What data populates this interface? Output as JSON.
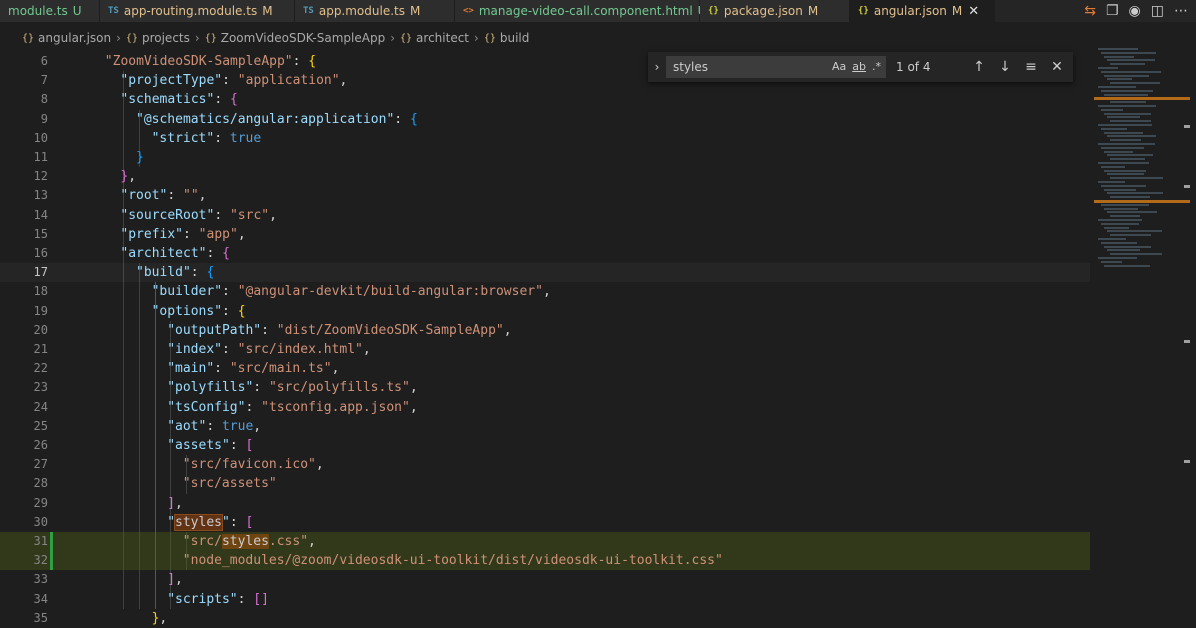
{
  "tabs": [
    {
      "icon": "",
      "label": "module.ts",
      "mark": "U",
      "icon_color": "",
      "label_color": "#73c991",
      "active": false
    },
    {
      "icon": "TS",
      "label": "app-routing.module.ts",
      "mark": "M",
      "icon_color": "#519aba",
      "label_color": "#e2c08d",
      "active": false
    },
    {
      "icon": "TS",
      "label": "app.module.ts",
      "mark": "M",
      "icon_color": "#519aba",
      "label_color": "#e2c08d",
      "active": false
    },
    {
      "icon": "<>",
      "label": "manage-video-call.component.html",
      "mark": "U",
      "icon_color": "#e37933",
      "label_color": "#73c991",
      "active": false
    },
    {
      "icon": "{}",
      "label": "package.json",
      "mark": "M",
      "icon_color": "#cbcb41",
      "label_color": "#e2c08d",
      "active": false
    },
    {
      "icon": "{}",
      "label": "angular.json",
      "mark": "M",
      "icon_color": "#cbcb41",
      "label_color": "#e2c08d",
      "active": true
    }
  ],
  "breadcrumb": [
    {
      "icon": "{}",
      "label": "angular.json"
    },
    {
      "icon": "{}",
      "label": "projects"
    },
    {
      "icon": "{}",
      "label": "ZoomVideoSDK-SampleApp"
    },
    {
      "icon": "{}",
      "label": "architect"
    },
    {
      "icon": "{}",
      "label": "build"
    }
  ],
  "find": {
    "query": "styles",
    "match_case": "Aa",
    "whole_word": "ab",
    "regex": ".*",
    "count": "1 of 4"
  },
  "editor": {
    "lines": [
      {
        "n": "6",
        "indent": 6,
        "tokens": [
          [
            "s",
            "\"ZoomVideoSDK-SampleApp\""
          ],
          [
            "p",
            ": "
          ],
          [
            "br1",
            "{"
          ]
        ]
      },
      {
        "n": "7",
        "indent": 8,
        "tokens": [
          [
            "k",
            "\"projectType\""
          ],
          [
            "p",
            ": "
          ],
          [
            "s",
            "\"application\""
          ],
          [
            "p",
            ","
          ]
        ]
      },
      {
        "n": "8",
        "indent": 8,
        "tokens": [
          [
            "k",
            "\"schematics\""
          ],
          [
            "p",
            ": "
          ],
          [
            "br2",
            "{"
          ]
        ]
      },
      {
        "n": "9",
        "indent": 10,
        "tokens": [
          [
            "k",
            "\"@schematics/angular:application\""
          ],
          [
            "p",
            ": "
          ],
          [
            "br3",
            "{"
          ]
        ]
      },
      {
        "n": "10",
        "indent": 12,
        "tokens": [
          [
            "k",
            "\"strict\""
          ],
          [
            "p",
            ": "
          ],
          [
            "b",
            "true"
          ]
        ]
      },
      {
        "n": "11",
        "indent": 10,
        "tokens": [
          [
            "br3",
            "}"
          ]
        ]
      },
      {
        "n": "12",
        "indent": 8,
        "tokens": [
          [
            "br2",
            "}"
          ],
          [
            "p",
            ","
          ]
        ]
      },
      {
        "n": "13",
        "indent": 8,
        "tokens": [
          [
            "k",
            "\"root\""
          ],
          [
            "p",
            ": "
          ],
          [
            "s",
            "\"\""
          ],
          [
            "p",
            ","
          ]
        ]
      },
      {
        "n": "14",
        "indent": 8,
        "tokens": [
          [
            "k",
            "\"sourceRoot\""
          ],
          [
            "p",
            ": "
          ],
          [
            "s",
            "\"src\""
          ],
          [
            "p",
            ","
          ]
        ]
      },
      {
        "n": "15",
        "indent": 8,
        "tokens": [
          [
            "k",
            "\"prefix\""
          ],
          [
            "p",
            ": "
          ],
          [
            "s",
            "\"app\""
          ],
          [
            "p",
            ","
          ]
        ]
      },
      {
        "n": "16",
        "indent": 8,
        "tokens": [
          [
            "k",
            "\"architect\""
          ],
          [
            "p",
            ": "
          ],
          [
            "br2",
            "{"
          ]
        ]
      },
      {
        "n": "17",
        "indent": 10,
        "tokens": [
          [
            "k",
            "\"build\""
          ],
          [
            "p",
            ": "
          ],
          [
            "br3",
            "{"
          ]
        ]
      },
      {
        "n": "18",
        "indent": 12,
        "tokens": [
          [
            "k",
            "\"builder\""
          ],
          [
            "p",
            ": "
          ],
          [
            "s",
            "\"@angular-devkit/build-angular:browser\""
          ],
          [
            "p",
            ","
          ]
        ]
      },
      {
        "n": "19",
        "indent": 12,
        "tokens": [
          [
            "k",
            "\"options\""
          ],
          [
            "p",
            ": "
          ],
          [
            "br1",
            "{"
          ]
        ]
      },
      {
        "n": "20",
        "indent": 14,
        "tokens": [
          [
            "k",
            "\"outputPath\""
          ],
          [
            "p",
            ": "
          ],
          [
            "s",
            "\"dist/ZoomVideoSDK-SampleApp\""
          ],
          [
            "p",
            ","
          ]
        ]
      },
      {
        "n": "21",
        "indent": 14,
        "tokens": [
          [
            "k",
            "\"index\""
          ],
          [
            "p",
            ": "
          ],
          [
            "s",
            "\"src/index.html\""
          ],
          [
            "p",
            ","
          ]
        ]
      },
      {
        "n": "22",
        "indent": 14,
        "tokens": [
          [
            "k",
            "\"main\""
          ],
          [
            "p",
            ": "
          ],
          [
            "s",
            "\"src/main.ts\""
          ],
          [
            "p",
            ","
          ]
        ]
      },
      {
        "n": "23",
        "indent": 14,
        "tokens": [
          [
            "k",
            "\"polyfills\""
          ],
          [
            "p",
            ": "
          ],
          [
            "s",
            "\"src/polyfills.ts\""
          ],
          [
            "p",
            ","
          ]
        ]
      },
      {
        "n": "24",
        "indent": 14,
        "tokens": [
          [
            "k",
            "\"tsConfig\""
          ],
          [
            "p",
            ": "
          ],
          [
            "s",
            "\"tsconfig.app.json\""
          ],
          [
            "p",
            ","
          ]
        ]
      },
      {
        "n": "25",
        "indent": 14,
        "tokens": [
          [
            "k",
            "\"aot\""
          ],
          [
            "p",
            ": "
          ],
          [
            "b",
            "true"
          ],
          [
            "p",
            ","
          ]
        ]
      },
      {
        "n": "26",
        "indent": 14,
        "tokens": [
          [
            "k",
            "\"assets\""
          ],
          [
            "p",
            ": "
          ],
          [
            "br2",
            "["
          ]
        ]
      },
      {
        "n": "27",
        "indent": 16,
        "tokens": [
          [
            "s",
            "\"src/favicon.ico\""
          ],
          [
            "p",
            ","
          ]
        ]
      },
      {
        "n": "28",
        "indent": 16,
        "tokens": [
          [
            "s",
            "\"src/assets\""
          ]
        ]
      },
      {
        "n": "29",
        "indent": 14,
        "tokens": [
          [
            "br2",
            "]"
          ],
          [
            "p",
            ","
          ]
        ]
      },
      {
        "n": "30",
        "indent": 14,
        "tokens": [
          [
            "k",
            "\""
          ],
          [
            "hl",
            "styles"
          ],
          [
            "k",
            "\""
          ],
          [
            "p",
            ": "
          ],
          [
            "br2",
            "["
          ]
        ]
      },
      {
        "n": "31",
        "indent": 16,
        "tokens": [
          [
            "s",
            "\"src/"
          ],
          [
            "hl2",
            "styles"
          ],
          [
            "s",
            ".css\""
          ],
          [
            "p",
            ","
          ]
        ]
      },
      {
        "n": "32",
        "indent": 16,
        "tokens": [
          [
            "s",
            "\"node_modules/@zoom/videosdk-ui-toolkit/dist/videosdk-ui-toolkit.css\""
          ]
        ]
      },
      {
        "n": "33",
        "indent": 14,
        "tokens": [
          [
            "br2",
            "]"
          ],
          [
            "p",
            ","
          ]
        ]
      },
      {
        "n": "34",
        "indent": 14,
        "tokens": [
          [
            "k",
            "\"scripts\""
          ],
          [
            "p",
            ": "
          ],
          [
            "br2",
            "[]"
          ]
        ]
      },
      {
        "n": "35",
        "indent": 12,
        "tokens": [
          [
            "br1",
            "}"
          ],
          [
            "p",
            ","
          ]
        ]
      }
    ],
    "current_line": "17",
    "added_lines": [
      "31",
      "32"
    ]
  },
  "colors": {
    "accent": "#007acc",
    "find_highlight": "#613214",
    "added_line": "#5a6e14"
  }
}
